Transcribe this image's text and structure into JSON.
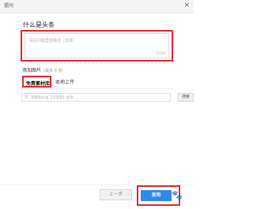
{
  "window": {
    "title": "提问",
    "close_symbol": "×"
  },
  "question": {
    "label": "什么是头条",
    "placeholder": "请在问题里面描述（选填）",
    "counter": "0/500"
  },
  "image_section": {
    "label": "添加图片",
    "note": "（最多 9 张）",
    "tabs": [
      {
        "label": "免费素材库",
        "active": true
      },
      {
        "label": "本地上传",
        "active": false
      }
    ]
  },
  "search": {
    "placeholder": "免费图片由【百度图】提供",
    "button": "搜索"
  },
  "footer": {
    "prev_button": "上一步",
    "publish_button": "发布",
    "accent_color": "#2f8ae6",
    "highlight_color": "#e0262d"
  }
}
